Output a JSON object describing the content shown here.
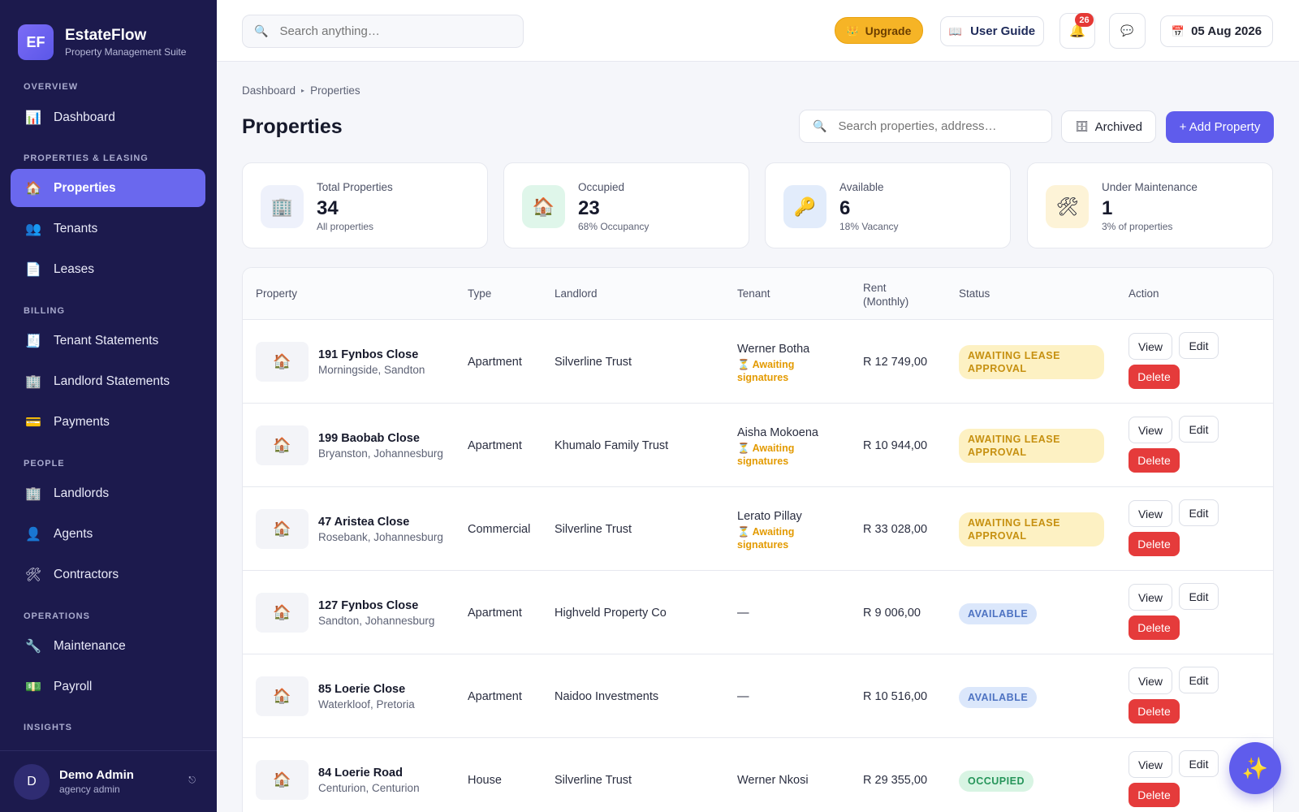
{
  "brand": {
    "logo": "EF",
    "name": "EstateFlow",
    "subtitle": "Property Management Suite"
  },
  "sidebar": {
    "sections": {
      "overview": "OVERVIEW",
      "leasing": "PROPERTIES & LEASING",
      "billing": "BILLING",
      "people": "PEOPLE",
      "operations": "OPERATIONS",
      "insights": "INSIGHTS"
    },
    "items": [
      {
        "label": "Dashboard",
        "icon": "📊"
      },
      {
        "label": "Properties",
        "icon": "🏠"
      },
      {
        "label": "Tenants",
        "icon": "👥"
      },
      {
        "label": "Leases",
        "icon": "📄"
      },
      {
        "label": "Tenant Statements",
        "icon": "🧾"
      },
      {
        "label": "Landlord Statements",
        "icon": "🏢"
      },
      {
        "label": "Payments",
        "icon": "💳"
      },
      {
        "label": "Landlords",
        "icon": "🏢"
      },
      {
        "label": "Agents",
        "icon": "👤"
      },
      {
        "label": "Contractors",
        "icon": "🛠"
      },
      {
        "label": "Maintenance",
        "icon": "🔧"
      },
      {
        "label": "Payroll",
        "icon": "💵"
      }
    ],
    "user": {
      "initial": "D",
      "name": "Demo Admin",
      "role": "agency admin",
      "options_icon": "⎋"
    }
  },
  "topbar": {
    "search_placeholder": "Search anything…",
    "search_icon": "🔍",
    "upgrade_label": "Upgrade",
    "upgrade_icon": "👑",
    "guide_label": "User Guide",
    "guide_icon": "📖",
    "bell_icon": "🔔",
    "notification_count": "26",
    "chat_icon": "💬",
    "date": "05 Aug 2026",
    "calendar_icon": "📅"
  },
  "breadcrumb": {
    "root": "Dashboard",
    "current": "Properties",
    "separator": "▸"
  },
  "page": {
    "title": "Properties",
    "search_placeholder": "Search properties, address…",
    "search_icon": "🔍",
    "archived_label": "Archived",
    "archived_icon": "🗄",
    "add_label": "+ Add Property"
  },
  "stats": [
    {
      "label": "Total Properties",
      "value": "34",
      "sub": "All properties",
      "icon": "🏢",
      "bg": "#eef1fb"
    },
    {
      "label": "Occupied",
      "value": "23",
      "sub": "68% Occupancy",
      "icon": "🏠",
      "bg": "#dff6ea"
    },
    {
      "label": "Available",
      "value": "6",
      "sub": "18% Vacancy",
      "icon": "🔑",
      "bg": "#e2ecfb"
    },
    {
      "label": "Under Maintenance",
      "value": "1",
      "sub": "3% of properties",
      "icon": "🛠",
      "bg": "#fdf3d7"
    }
  ],
  "table": {
    "headers": {
      "property": "Property",
      "type": "Type",
      "landlord": "Landlord",
      "tenant": "Tenant",
      "rent_line1": "Rent",
      "rent_line2": "(Monthly)",
      "status": "Status",
      "action": "Action"
    },
    "actions": {
      "view": "View",
      "edit": "Edit",
      "delete": "Delete"
    },
    "thumb_icon": "🏠",
    "rows": [
      {
        "name": "191 Fynbos Close",
        "address": "Morningside, Sandton",
        "type": "Apartment",
        "landlord": "Silverline Trust",
        "tenant": "Werner Botha",
        "tenant_note": "⏳ Awaiting signatures",
        "rent": "R 12 749,00",
        "status": "AWAITING LEASE APPROVAL",
        "status_kind": "await"
      },
      {
        "name": "199 Baobab Close",
        "address": "Bryanston, Johannesburg",
        "type": "Apartment",
        "landlord": "Khumalo Family Trust",
        "tenant": "Aisha Mokoena",
        "tenant_note": "⏳ Awaiting signatures",
        "rent": "R 10 944,00",
        "status": "AWAITING LEASE APPROVAL",
        "status_kind": "await"
      },
      {
        "name": "47 Aristea Close",
        "address": "Rosebank, Johannesburg",
        "type": "Commercial",
        "landlord": "Silverline Trust",
        "tenant": "Lerato Pillay",
        "tenant_note": "⏳ Awaiting signatures",
        "rent": "R 33 028,00",
        "status": "AWAITING LEASE APPROVAL",
        "status_kind": "await"
      },
      {
        "name": "127 Fynbos Close",
        "address": "Sandton, Johannesburg",
        "type": "Apartment",
        "landlord": "Highveld Property Co",
        "tenant": "—",
        "tenant_note": "",
        "rent": "R 9 006,00",
        "status": "AVAILABLE",
        "status_kind": "avail"
      },
      {
        "name": "85 Loerie Close",
        "address": "Waterkloof, Pretoria",
        "type": "Apartment",
        "landlord": "Naidoo Investments",
        "tenant": "—",
        "tenant_note": "",
        "rent": "R 10 516,00",
        "status": "AVAILABLE",
        "status_kind": "avail"
      },
      {
        "name": "84 Loerie Road",
        "address": "Centurion, Centurion",
        "type": "House",
        "landlord": "Silverline Trust",
        "tenant": "Werner Nkosi",
        "tenant_note": "",
        "rent": "R 29 355,00",
        "status": "OCCUPIED",
        "status_kind": "occ"
      }
    ]
  },
  "fab_icon": "✨"
}
